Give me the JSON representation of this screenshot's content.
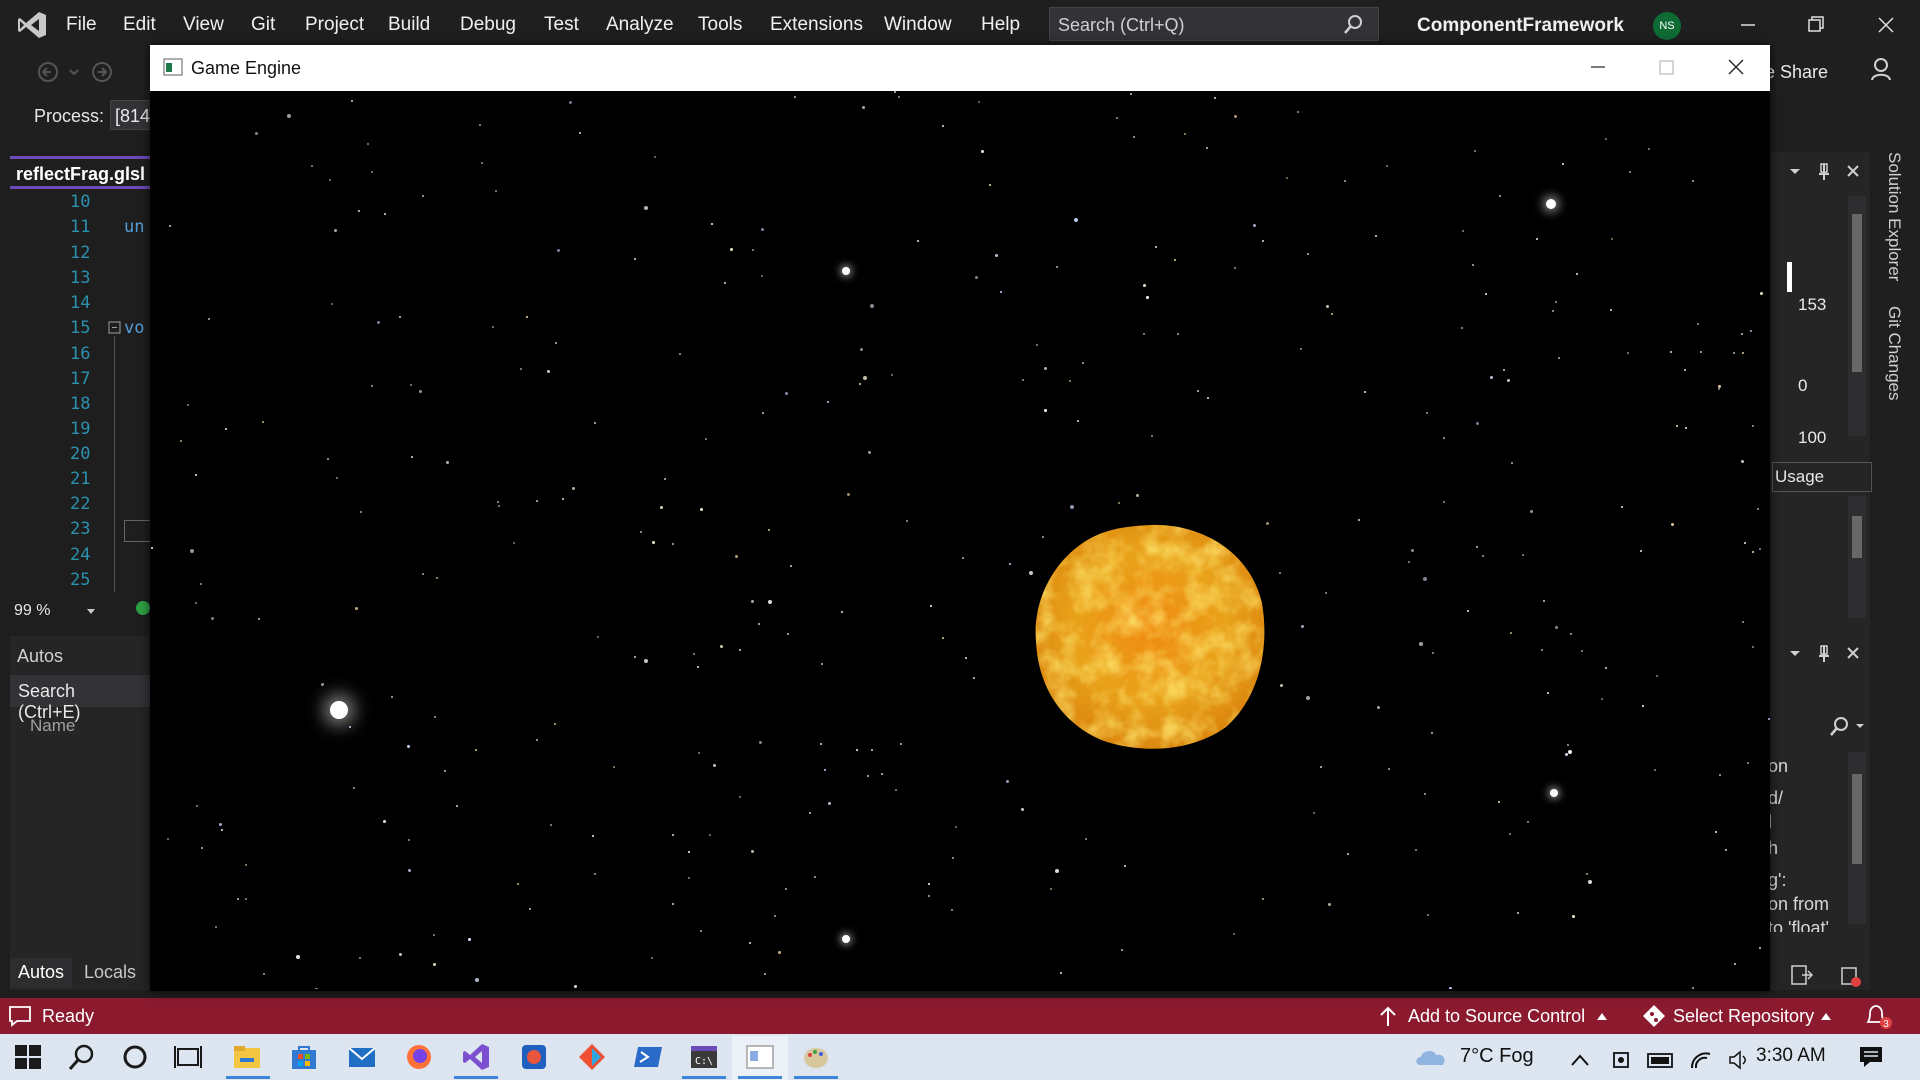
{
  "vs": {
    "menu": [
      "File",
      "Edit",
      "View",
      "Git",
      "Project",
      "Build",
      "Debug",
      "Test",
      "Analyze",
      "Tools",
      "Extensions",
      "Window",
      "Help"
    ],
    "search_placeholder": "Search (Ctrl+Q)",
    "solution_name": "ComponentFramework",
    "user_initials": "NS",
    "live_share": "e Share",
    "process_label": "Process:",
    "process_value": "[814",
    "editor": {
      "tab": "reflectFrag.glsl",
      "line_numbers": [
        "10",
        "11",
        "12",
        "13",
        "14",
        "15",
        "16",
        "17",
        "18",
        "19",
        "20",
        "21",
        "22",
        "23",
        "24",
        "25"
      ],
      "line11_fragment": "un",
      "line15_fragment": "vo",
      "zoom": "99 %"
    },
    "autos": {
      "title": "Autos",
      "search": "Search (Ctrl+E)",
      "name_header": "Name",
      "tab_autos": "Autos",
      "tab_locals": "Locals"
    },
    "right_panels": {
      "solution_explorer": "Solution Explorer",
      "git_changes": "Git Changes",
      "value_153": "153",
      "value_0": "0",
      "value_100": "100",
      "usage": "Usage",
      "output_fragments": [
        "on",
        "d/",
        "l",
        "h",
        "g':",
        "on from",
        "to 'float'"
      ]
    },
    "statusbar": {
      "ready": "Ready",
      "add_to_source": "Add to Source Control",
      "select_repo": "Select Repository",
      "notifications": "3"
    }
  },
  "game_window": {
    "title": "Game Engine"
  },
  "taskbar": {
    "weather": "7°C  Fog",
    "time": "3:30 AM"
  }
}
